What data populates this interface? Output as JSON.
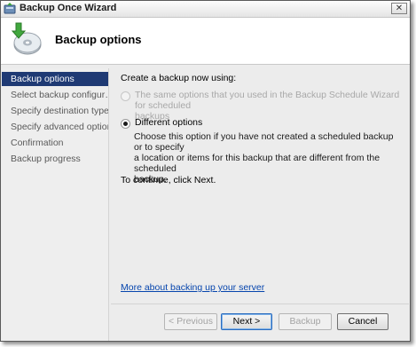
{
  "window": {
    "title": "Backup Once Wizard",
    "close_glyph": "✕"
  },
  "header": {
    "title": "Backup options",
    "icon": "backup-disk-icon"
  },
  "sidebar": {
    "items": [
      {
        "label": "Backup options",
        "active": true
      },
      {
        "label": "Select backup configur…",
        "active": false
      },
      {
        "label": "Specify destination type",
        "active": false
      },
      {
        "label": "Specify advanced option",
        "active": false
      },
      {
        "label": "Confirmation",
        "active": false
      },
      {
        "label": "Backup progress",
        "active": false
      }
    ]
  },
  "main": {
    "lead": "Create a backup now using:",
    "option_same": {
      "label_line1": "The same options that you used in the Backup Schedule Wizard for scheduled",
      "label_line2": "backups",
      "enabled": false,
      "selected": false
    },
    "option_different": {
      "label": "Different options",
      "enabled": true,
      "selected": true,
      "description_line1": "Choose this option if you have not created a scheduled backup or to specify",
      "description_line2": "a location or items for this backup that are different from the scheduled",
      "description_line3": "backup."
    },
    "continue_text": "To continue, click Next.",
    "more_link": "More about backing up your server"
  },
  "buttons": {
    "previous": "< Previous",
    "next": "Next >",
    "backup": "Backup",
    "cancel": "Cancel"
  },
  "colors": {
    "sidebar_active_bg": "#1f3a74",
    "link": "#0645ad"
  }
}
